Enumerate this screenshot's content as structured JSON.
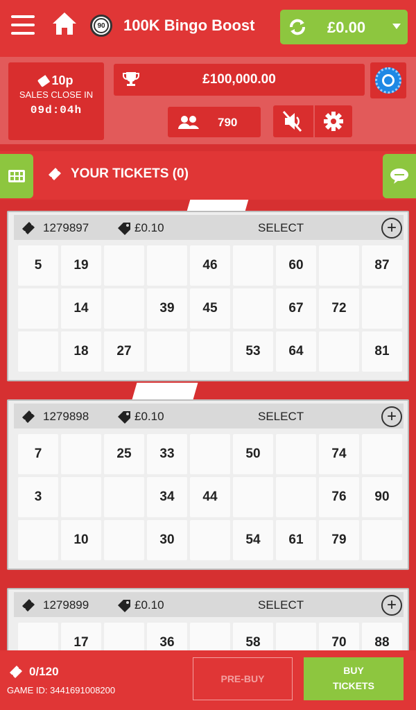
{
  "header": {
    "title": "100K Bingo Boost",
    "ball_label": "90",
    "balance": "£0.00"
  },
  "info": {
    "ticket_price": "10p",
    "sales_close_label": "SALES CLOSE IN",
    "countdown": "09d:04h",
    "jackpot": "£100,000.00",
    "players": "790"
  },
  "tickets_bar": {
    "label": "YOUR TICKETS (0)"
  },
  "tickets": [
    {
      "number": "1279897",
      "price": "£0.10",
      "select_label": "SELECT",
      "rows": [
        [
          "5",
          "19",
          "",
          "",
          "46",
          "",
          "60",
          "",
          "87"
        ],
        [
          "",
          "14",
          "",
          "39",
          "45",
          "",
          "67",
          "72",
          ""
        ],
        [
          "",
          "18",
          "27",
          "",
          "",
          "53",
          "64",
          "",
          "81"
        ]
      ]
    },
    {
      "number": "1279898",
      "price": "£0.10",
      "select_label": "SELECT",
      "rows": [
        [
          "7",
          "",
          "25",
          "33",
          "",
          "50",
          "",
          "74",
          ""
        ],
        [
          "3",
          "",
          "",
          "34",
          "44",
          "",
          "",
          "76",
          "90"
        ],
        [
          "",
          "10",
          "",
          "30",
          "",
          "54",
          "61",
          "79",
          ""
        ]
      ]
    },
    {
      "number": "1279899",
      "price": "£0.10",
      "select_label": "SELECT",
      "rows": [
        [
          "",
          "17",
          "",
          "36",
          "",
          "58",
          "",
          "70",
          "88"
        ]
      ]
    }
  ],
  "footer": {
    "ticket_count": "0/120",
    "game_id": "GAME ID: 3441691008200",
    "prebuy_label": "PRE-BUY",
    "buy_label_line1": "BUY",
    "buy_label_line2": "TICKETS"
  },
  "colors": {
    "brand_red": "#e03636",
    "accent_green": "#8dc63f",
    "icon_blue": "#1e88e5"
  }
}
